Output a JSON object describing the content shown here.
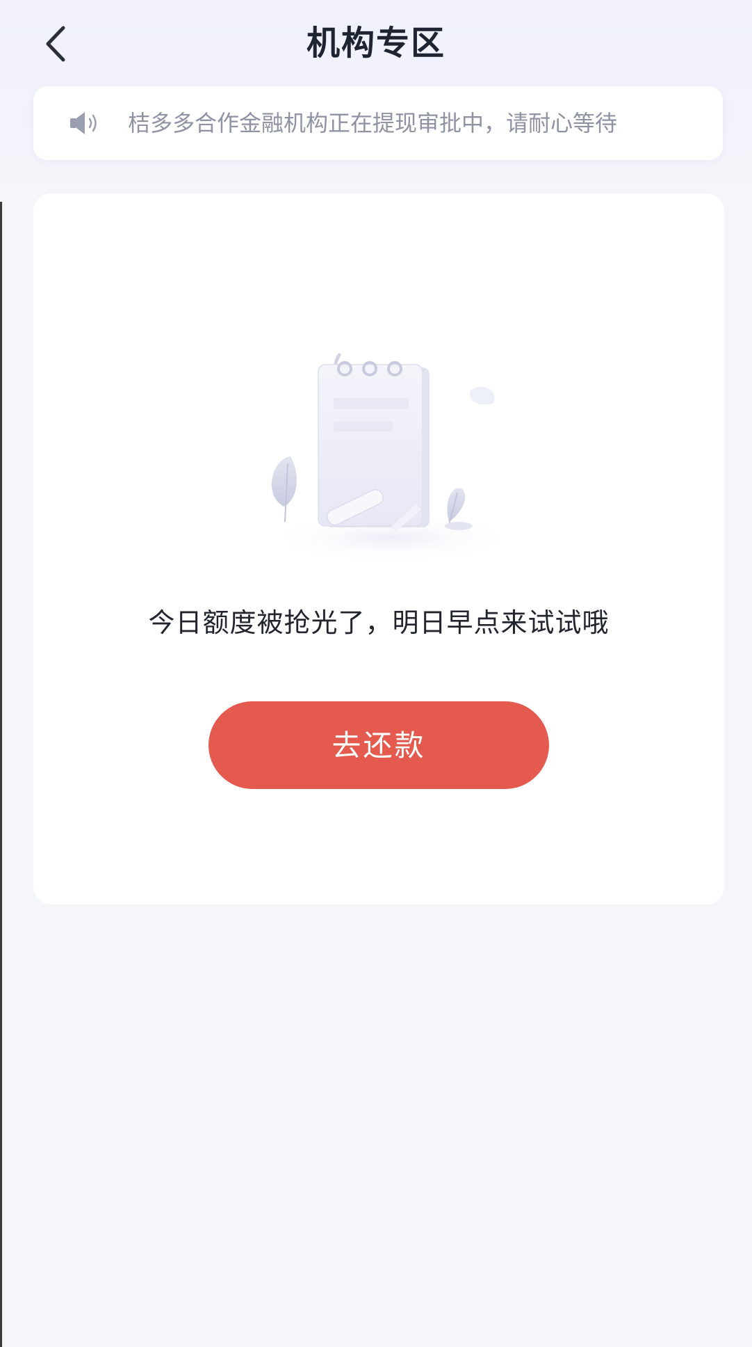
{
  "header": {
    "title": "机构专区",
    "back_icon": "chevron-left-icon"
  },
  "notice": {
    "icon": "speaker-icon",
    "text": "桔多多合作金融机构正在提现审批中，请耐心等待"
  },
  "empty_state": {
    "illustration": "empty-notebook-illustration",
    "message": "今日额度被抢光了，明日早点来试试哦",
    "button_label": "去还款"
  },
  "colors": {
    "accent": "#e55a4e",
    "page_bg": "#f5f6fa",
    "title": "#1f2433",
    "notice_text": "#8e92a3"
  }
}
